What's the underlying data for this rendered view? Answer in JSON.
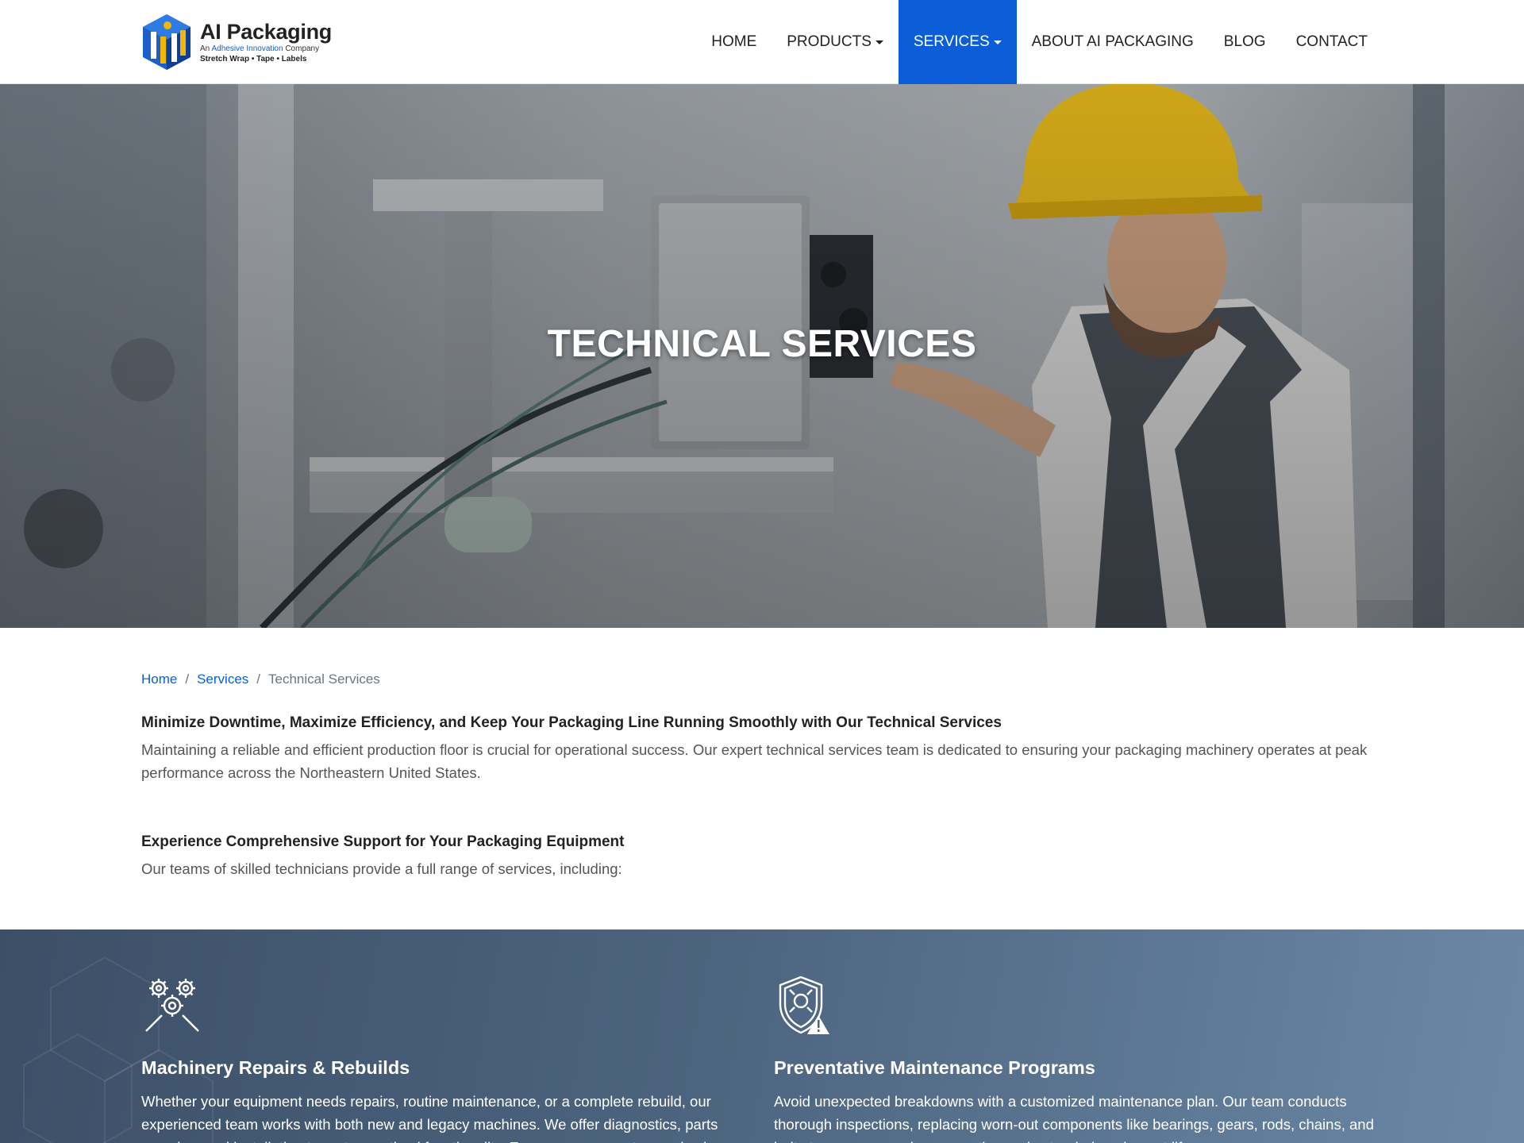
{
  "brand": {
    "name": "AI Packaging",
    "tagline_prefix": "An ",
    "tagline_highlight": "Adhesive Innovation",
    "tagline_suffix": " Company",
    "subline": "Stretch Wrap • Tape • Labels"
  },
  "nav": {
    "items": [
      {
        "label": "HOME"
      },
      {
        "label": "PRODUCTS"
      },
      {
        "label": "SERVICES"
      },
      {
        "label": "ABOUT AI PACKAGING"
      },
      {
        "label": "BLOG"
      },
      {
        "label": "CONTACT"
      }
    ],
    "active_color": "#0b5ed7"
  },
  "hero": {
    "title": "TECHNICAL SERVICES"
  },
  "breadcrumb": {
    "home": "Home",
    "separator": "/",
    "services": "Services",
    "current": "Technical Services"
  },
  "intro": {
    "heading": "Minimize Downtime, Maximize Efficiency, and Keep Your Packaging Line Running Smoothly with Our Technical Services",
    "text": "Maintaining a reliable and efficient production floor is crucial for operational success. Our expert technical services team is dedicated to ensuring your packaging machinery operates at peak performance across the Northeastern United States."
  },
  "support": {
    "heading": "Experience Comprehensive Support for Your Packaging Equipment",
    "text": "Our teams of skilled technicians provide a full range of services, including:"
  },
  "services": [
    {
      "icon": "gears-wrench-icon",
      "title": "Machinery Repairs & Rebuilds",
      "text": "Whether your equipment needs repairs, routine maintenance, or a complete rebuild, our experienced team works with both new and legacy machines. We offer diagnostics, parts sourcing, and installation to restore optimal functionality. Emergency support may also be"
    },
    {
      "icon": "shield-maintenance-icon",
      "title": "Preventative Maintenance Programs",
      "text": "Avoid unexpected breakdowns with a customized maintenance plan. Our team conducts thorough inspections, replacing worn-out components like bearings, gears, rods, chains, and belts to ensure seamless operation and extended equipment lifespan."
    }
  ]
}
